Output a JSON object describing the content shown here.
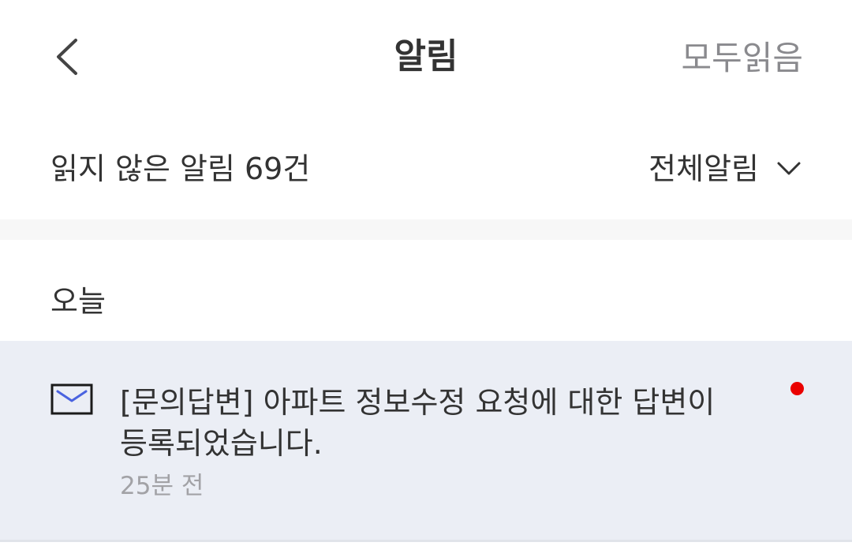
{
  "header": {
    "back_icon": "chevron-left-icon",
    "title": "알림",
    "read_all_label": "모두읽음"
  },
  "summary": {
    "unread_label": "읽지 않은 알림 69건",
    "filter_label": "전체알림",
    "filter_icon": "chevron-down-icon"
  },
  "section": {
    "title": "오늘"
  },
  "notifications": [
    {
      "icon": "mail-icon",
      "text": "[문의답변] 아파트 정보수정 요청에 대한 답변이 등록되었습니다.",
      "time": "25분 전",
      "unread": true
    }
  ],
  "colors": {
    "text_primary": "#333333",
    "text_secondary": "#8a8a8e",
    "notification_bg": "#ebeef5",
    "unread_dot": "#ea0000",
    "mail_icon_stroke": "#1a1a1a",
    "mail_icon_flap": "#4a63e0"
  }
}
